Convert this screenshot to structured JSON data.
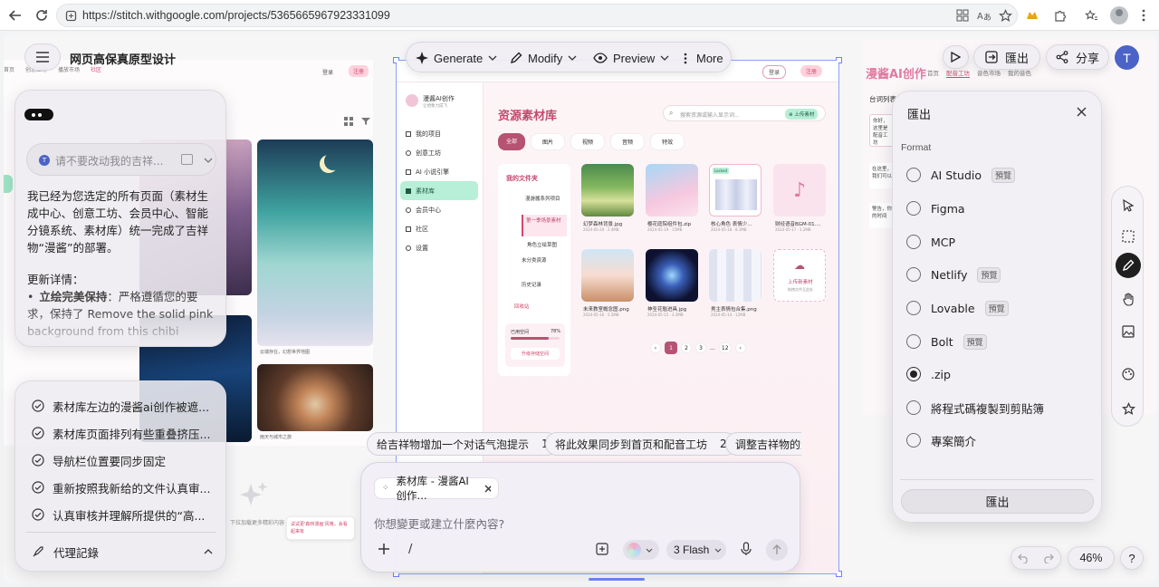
{
  "browser": {
    "url": "https://stitch.withgoogle.com/projects/5365665967923331099"
  },
  "project": {
    "title": "网页高保真原型设计"
  },
  "toolbar": {
    "generate": "Generate",
    "modify": "Modify",
    "preview": "Preview",
    "more": "More"
  },
  "top_right": {
    "export": "匯出",
    "share": "分享",
    "avatar": "T"
  },
  "left_frame": {
    "nav": [
      "首页",
      "创意工坊",
      "播放市场",
      "社区"
    ],
    "login": "登录",
    "register": "注册",
    "caption1": "云端存在，幻想世界地图",
    "caption2": "雨天与城市之旅",
    "bottom_text": "下拉加载更多精彩内容",
    "tip": "试试更'森林漫画'风格，会看起来有"
  },
  "chat": {
    "collapsed_prompt": "请不要改动我的吉祥...",
    "message": "我已经为您选定的所有页面（素材生成中心、创意工坊、会员中心、智能分镜系统、素材库）统一完成了吉祥物“漫酱”的部署。",
    "update_title": "更新详情：",
    "bullet_bold": "立绘完美保持",
    "bullet_text": "：严格遵循您的要求，保持了 Remove the solid pink background from this chibi anime"
  },
  "tasks": {
    "items": [
      "素材库左边的漫酱ai创作被遮...",
      "素材库页面排列有些重叠挤压...",
      "导航栏位置要同步固定",
      "重新按照我新给的文件认真审...",
      "认真审核并理解所提供的“高..."
    ],
    "log": "代理記錄"
  },
  "center": {
    "brand": "漫酱AI创作",
    "brand_sub": "让想象力成飞",
    "login": "登录",
    "register": "注册",
    "title": "资源素材库",
    "search_placeholder": "搜索资源或输入显示词...",
    "upload_btn": "⊕ 上传素材",
    "nav": [
      "我的项目",
      "创意工坊",
      "AI 小说引擎",
      "素材库",
      "会员中心",
      "社区",
      "设置"
    ],
    "tabs": [
      "全部",
      "图片",
      "视频",
      "音频",
      "特效"
    ],
    "folders_title": "我的文件夹",
    "folders": [
      "漫游酱系列项目",
      "第一季场景素材",
      "角色立绘草图",
      "未分类资源",
      "历史记录"
    ],
    "trash": "回收站",
    "storage_label": "已用空间",
    "storage_pct": "78%",
    "storage_fraction": 0.78,
    "storage_btn": "升级存储空间",
    "assets": [
      {
        "name": "幻梦森林背景.jpg",
        "meta": "2024-05-20 · 2.4MB"
      },
      {
        "name": "樱花庭院组件包.zip",
        "meta": "2024-05-19 · 15MB"
      },
      {
        "name": "核心角色 表情少...",
        "meta": "2024-05-18 · 8.1MB"
      },
      {
        "name": "财经语音BGM-01....",
        "meta": "2024-05-17 · 3.2MB"
      },
      {
        "name": "未来教室概念图.png",
        "meta": "2024-05-16 · 5.5MB"
      },
      {
        "name": "神圣花魁进具.jpg",
        "meta": "2024-05-15 · 3.3MB"
      },
      {
        "name": "男主表情包合集.png",
        "meta": "2024-05-14 · 12MB"
      },
      {
        "name": "上传新素材",
        "meta": "拖拽文件至此处"
      }
    ],
    "badge_locked": "Locked",
    "pages": [
      "1",
      "2",
      "3",
      "...",
      "12"
    ]
  },
  "right_frame": {
    "brand": "漫酱AI创作",
    "nav": [
      "首页",
      "配音工坊",
      "音色市场",
      "我的音色"
    ],
    "tab": "配音工坊",
    "heading": "台词列表",
    "q1": "你好，这里是配音工坊",
    "q2": "在这里，我们可以",
    "q3": "警告，你的时间"
  },
  "export_panel": {
    "title": "匯出",
    "format_label": "Format",
    "options": [
      {
        "label": "AI Studio",
        "tag": "預覽"
      },
      {
        "label": "Figma",
        "tag": ""
      },
      {
        "label": "MCP",
        "tag": ""
      },
      {
        "label": "Netlify",
        "tag": "預覽"
      },
      {
        "label": "Lovable",
        "tag": "預覽"
      },
      {
        "label": "Bolt",
        "tag": "預覽"
      },
      {
        "label": ".zip",
        "tag": ""
      },
      {
        "label": "將程式碼複製到剪貼簿",
        "tag": ""
      },
      {
        "label": "專案簡介",
        "tag": ""
      }
    ],
    "selected": ".zip",
    "export_button": "匯出"
  },
  "suggestions": [
    {
      "text": "给吉祥物增加一个对话气泡提示",
      "num": "1"
    },
    {
      "text": "将此效果同步到首页和配音工坊",
      "num": "2"
    },
    {
      "text": "调整吉祥物的大",
      "num": ""
    }
  ],
  "composer": {
    "attachment": "素材库 - 漫酱AI创作...",
    "placeholder": "你想變更或建立什麼內容?",
    "slash": "/",
    "model": "3 Flash"
  },
  "zoom": {
    "level": "46%",
    "help": "?"
  }
}
